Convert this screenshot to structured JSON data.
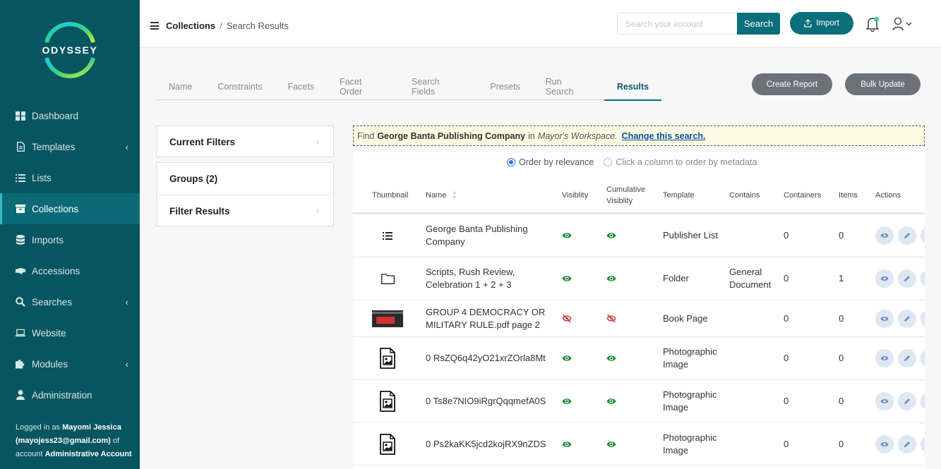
{
  "brand": {
    "name": "ODYSSEY"
  },
  "sidebar": {
    "items": [
      {
        "label": "Dashboard",
        "icon": "dashboard-icon",
        "chevron": false,
        "active": false
      },
      {
        "label": "Templates",
        "icon": "file-icon",
        "chevron": true,
        "active": false
      },
      {
        "label": "Lists",
        "icon": "list-icon",
        "chevron": false,
        "active": false
      },
      {
        "label": "Collections",
        "icon": "archive-box-icon",
        "chevron": false,
        "active": true
      },
      {
        "label": "Imports",
        "icon": "database-icon",
        "chevron": false,
        "active": false
      },
      {
        "label": "Accessions",
        "icon": "handshake-icon",
        "chevron": false,
        "active": false
      },
      {
        "label": "Searches",
        "icon": "search-icon",
        "chevron": true,
        "active": false
      },
      {
        "label": "Website",
        "icon": "laptop-icon",
        "chevron": false,
        "active": false
      },
      {
        "label": "Modules",
        "icon": "puzzle-icon",
        "chevron": true,
        "active": false
      },
      {
        "label": "Administration",
        "icon": "user-icon",
        "chevron": false,
        "active": false
      }
    ],
    "logged_prefix": "Logged in as",
    "user_name": "Mayomi Jessica",
    "user_email": "(mayojess23@gmail.com)",
    "account_prefix": "of account",
    "account_name": "Administrative Account"
  },
  "header": {
    "breadcrumb": {
      "parent": "Collections",
      "separator": "/",
      "current": "Search Results"
    },
    "search": {
      "placeholder": "Search your account",
      "value": "",
      "button": "Search"
    },
    "import_label": "Import"
  },
  "tabs": [
    "Name",
    "Constraints",
    "Facets",
    "Facet Order",
    "Search Fields",
    "Presets",
    "Run Search",
    "Results"
  ],
  "active_tab": "Results",
  "actions": {
    "create_report": "Create Report",
    "bulk_update": "Bulk Update"
  },
  "filters": {
    "current_filters": "Current Filters",
    "groups": "Groups (2)",
    "filter_results": "Filter Results"
  },
  "find_bar": {
    "prefix": "Find",
    "query": "George Banta Publishing Company",
    "middle": "in",
    "workspace": "Mayor's Workspace.",
    "link": "Change this search."
  },
  "ordering": {
    "relevance": "Order by relevance",
    "metadata": "Click a column to order by metadata",
    "selected": "relevance"
  },
  "table": {
    "headers": {
      "thumbnail": "Thumbnail",
      "name": "Name",
      "visibility": "Visiblity",
      "cumulative_1": "Cumulative",
      "cumulative_2": "Visiblity",
      "template": "Template",
      "contains": "Contains",
      "containers": "Containers",
      "items": "Items",
      "actions": "Actions"
    },
    "rows": [
      {
        "thumb": "list-icon",
        "name": "George Banta Publishing Company",
        "visible": true,
        "cumulative_visible": true,
        "template": "Publisher List",
        "contains": "",
        "containers": "0",
        "items": "0"
      },
      {
        "thumb": "folder-icon",
        "name": "Scripts, Rush Review, Celebration 1 + 2 + 3",
        "visible": true,
        "cumulative_visible": true,
        "template": "Folder",
        "contains": "General Document",
        "containers": "0",
        "items": "1"
      },
      {
        "thumb": "image-thumbnail",
        "name": "GROUP 4 DEMOCRACY OR MILITARY RULE.pdf page 2",
        "visible": false,
        "cumulative_visible": false,
        "template": "Book Page",
        "contains": "",
        "containers": "0",
        "items": "0"
      },
      {
        "thumb": "image-file-icon",
        "name": "0 RsZQ6q42yO21xrZOrla8Mt",
        "visible": true,
        "cumulative_visible": true,
        "template": "Photographic Image",
        "contains": "",
        "containers": "0",
        "items": "0"
      },
      {
        "thumb": "image-file-icon",
        "name": "0 Ts8e7NIO9iRgrQqqmefA0S",
        "visible": true,
        "cumulative_visible": true,
        "template": "Photographic Image",
        "contains": "",
        "containers": "0",
        "items": "0"
      },
      {
        "thumb": "image-file-icon",
        "name": "0 Ps2kaKK5jcd2kojRX9nZDS",
        "visible": true,
        "cumulative_visible": true,
        "template": "Photographic Image",
        "contains": "",
        "containers": "0",
        "items": "0"
      }
    ]
  },
  "colors": {
    "sidebar": "#075560",
    "accent": "#0b6e7a",
    "visible_eye": "#1f8a3c",
    "hidden_eye": "#d42b2b",
    "find_bar_bg": "#fafbe2"
  }
}
